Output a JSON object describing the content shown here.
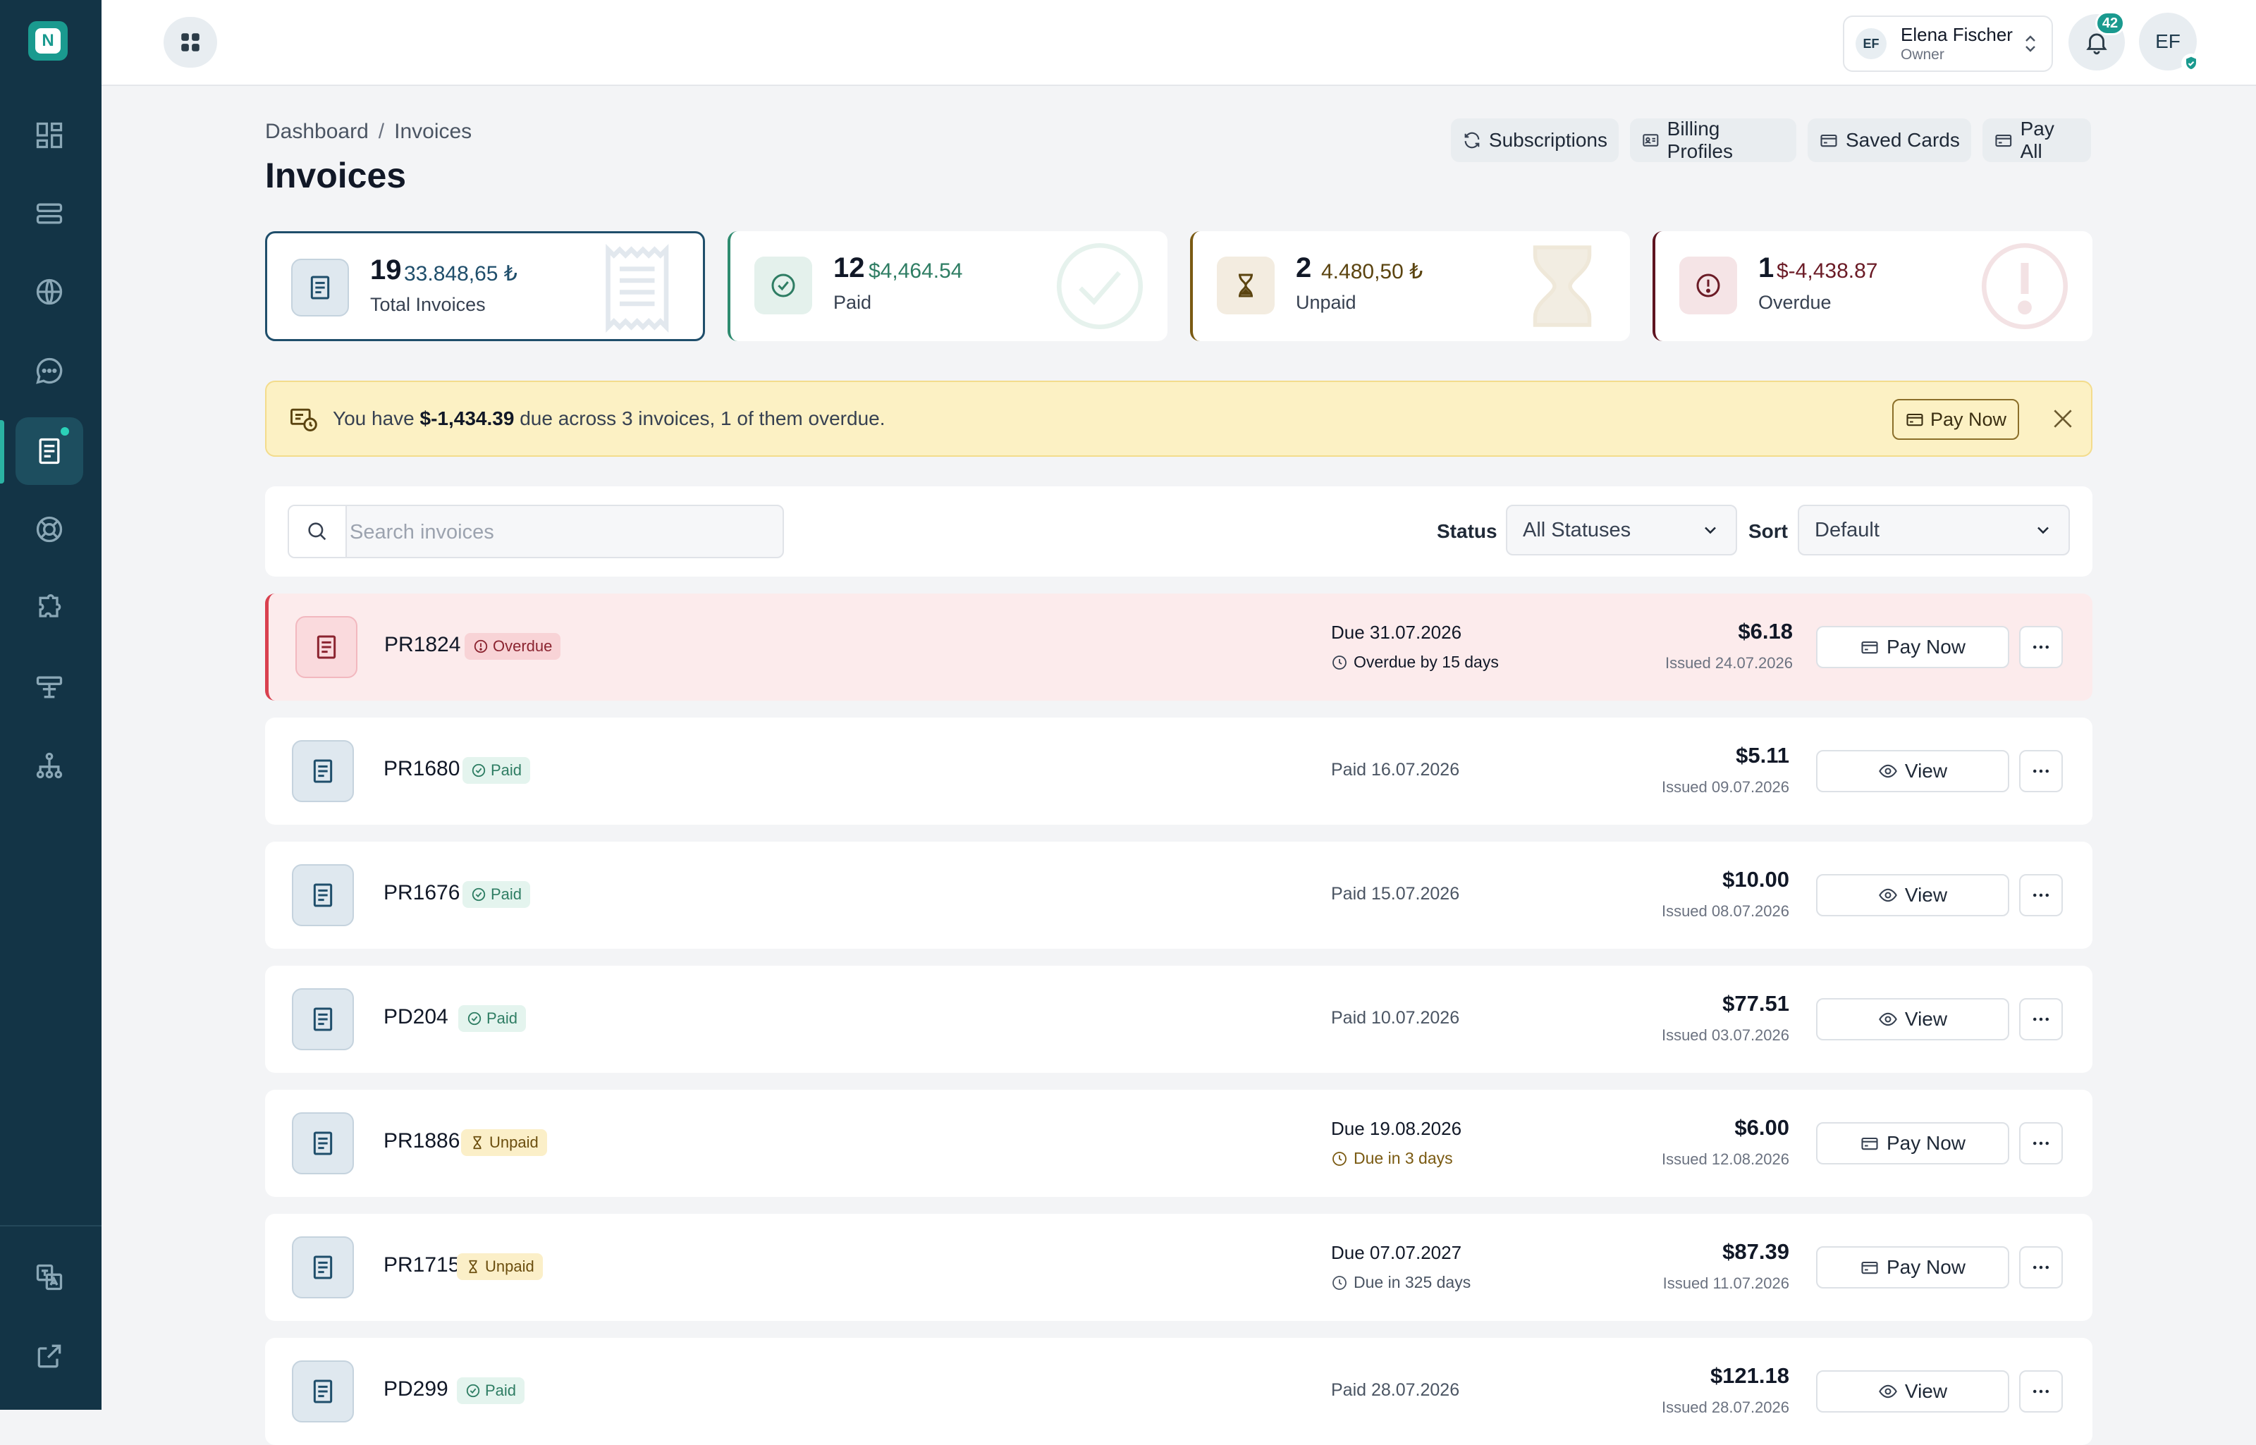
{
  "app": {
    "logo_letter": "N"
  },
  "user": {
    "initials": "EF",
    "name": "Elena Fischer",
    "role": "Owner",
    "avatar_initials": "EF"
  },
  "notifications": {
    "count": "42"
  },
  "breadcrumb": {
    "root": "Dashboard",
    "separator": "/",
    "current": "Invoices"
  },
  "page": {
    "title": "Invoices"
  },
  "header_actions": {
    "subscriptions": "Subscriptions",
    "billing_profiles": "Billing Profiles",
    "saved_cards": "Saved Cards",
    "pay_all": "Pay All"
  },
  "stats": {
    "total": {
      "count": "19",
      "amount": "33.848,65 ₺",
      "label": "Total Invoices"
    },
    "paid": {
      "count": "12",
      "amount": "$4,464.54",
      "label": "Paid"
    },
    "unpaid": {
      "count": "2",
      "amount": "4.480,50 ₺",
      "label": "Unpaid"
    },
    "overdue": {
      "count": "1",
      "amount": "$-4,438.87",
      "label": "Overdue"
    }
  },
  "alert": {
    "prefix": "You have",
    "amount": "$-1,434.39",
    "suffix": "due across 3 invoices, 1 of them overdue.",
    "button": "Pay Now"
  },
  "filters": {
    "search_placeholder": "Search invoices",
    "status_label": "Status",
    "status_value": "All Statuses",
    "sort_label": "Sort",
    "sort_value": "Default"
  },
  "invoices": [
    {
      "id": "PR1824",
      "status": "Overdue",
      "due": "Due 31.07.2026",
      "due_note": "Overdue by 15 days",
      "amount": "$6.18",
      "issued": "Issued 24.07.2026",
      "action": "Pay Now"
    },
    {
      "id": "PR1680",
      "status": "Paid",
      "due": "Paid 16.07.2026",
      "due_note": "",
      "amount": "$5.11",
      "issued": "Issued 09.07.2026",
      "action": "View"
    },
    {
      "id": "PR1676",
      "status": "Paid",
      "due": "Paid 15.07.2026",
      "due_note": "",
      "amount": "$10.00",
      "issued": "Issued 08.07.2026",
      "action": "View"
    },
    {
      "id": "PD204",
      "status": "Paid",
      "due": "Paid 10.07.2026",
      "due_note": "",
      "amount": "$77.51",
      "issued": "Issued 03.07.2026",
      "action": "View"
    },
    {
      "id": "PR1886",
      "status": "Unpaid",
      "due": "Due 19.08.2026",
      "due_note": "Due in 3 days",
      "amount": "$6.00",
      "issued": "Issued 12.08.2026",
      "action": "Pay Now"
    },
    {
      "id": "PR1715",
      "status": "Unpaid",
      "due": "Due 07.07.2027",
      "due_note": "Due in 325 days",
      "amount": "$87.39",
      "issued": "Issued 11.07.2026",
      "action": "Pay Now"
    },
    {
      "id": "PD299",
      "status": "Paid",
      "due": "Paid 28.07.2026",
      "due_note": "",
      "amount": "$121.18",
      "issued": "Issued 28.07.2026",
      "action": "View"
    }
  ],
  "colors": {
    "sidebar": "#133446",
    "accent": "#1a9a8f",
    "total_border": "#1f4e6b",
    "paid_border": "#2e8b6f",
    "unpaid_border": "#7a5a12",
    "overdue_border": "#5e1420",
    "alert_bg": "#fcf1c4"
  },
  "icons": {
    "sidebar": [
      "dashboard-icon",
      "server-icon",
      "globe-icon",
      "chat-icon",
      "invoice-icon",
      "support-icon",
      "puzzle-icon",
      "signpost-icon",
      "sitemap-icon",
      "translate-icon",
      "external-link-icon"
    ]
  }
}
